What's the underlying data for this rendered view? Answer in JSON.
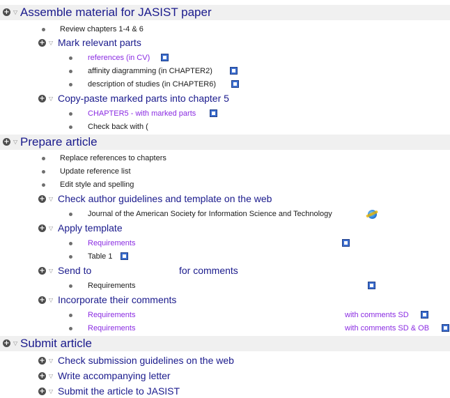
{
  "outline": {
    "sections": [
      {
        "title": "Assemble material for JASIST paper",
        "items": [
          {
            "text": "Review chapters 1-4 & 6"
          },
          {
            "heading": "Mark relevant parts",
            "items": [
              {
                "text": "references (in CV)",
                "link": true,
                "icon": "word-doc-icon"
              },
              {
                "text": "affinity diagramming (in CHAPTER2)",
                "icon": "word-doc-icon"
              },
              {
                "text": "description of studies (in CHAPTER6)",
                "icon": "word-doc-icon"
              }
            ]
          },
          {
            "heading": "Copy-paste marked parts into chapter 5",
            "items": [
              {
                "text": "CHAPTER5 - with marked parts",
                "link": true,
                "icon": "word-doc-icon"
              },
              {
                "text": "Check back with ("
              }
            ]
          }
        ]
      },
      {
        "title": "Prepare article",
        "items": [
          {
            "text": "Replace references to chapters"
          },
          {
            "text": "Update reference list"
          },
          {
            "text": "Edit style and spelling"
          },
          {
            "heading": "Check author guidelines and template on the web",
            "items": [
              {
                "text": "Journal of the American Society for Information Science and Technology",
                "icon": "web-link-icon"
              }
            ]
          },
          {
            "heading": "Apply template",
            "items": [
              {
                "text": "Requirements",
                "link": true,
                "icon": "word-doc-icon"
              },
              {
                "text": "Table 1",
                "icon": "word-doc-icon"
              }
            ]
          },
          {
            "heading_parts": [
              "Send to",
              "for comments"
            ],
            "items": [
              {
                "text": "Requirements",
                "icon": "word-doc-icon"
              }
            ]
          },
          {
            "heading": "Incorporate their comments",
            "items": [
              {
                "text": "Requirements",
                "suffix": "with comments SD",
                "link": true,
                "icon": "word-doc-icon"
              },
              {
                "text": "Requirements",
                "suffix": "with comments SD & OB",
                "link": true,
                "icon": "word-doc-icon"
              }
            ]
          }
        ]
      },
      {
        "title": "Submit article",
        "items": [
          {
            "heading": "Check submission guidelines on the web"
          },
          {
            "heading": "Write accompanying letter"
          },
          {
            "heading": "Submit the article to JASIST"
          }
        ]
      }
    ]
  }
}
